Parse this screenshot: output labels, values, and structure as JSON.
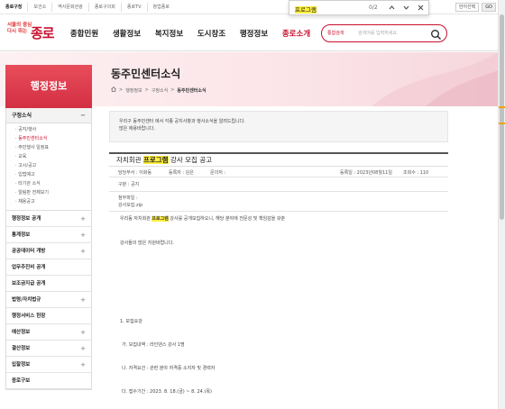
{
  "topbar": {
    "links": [
      "종로구청",
      "보건소",
      "역사문화관광",
      "종로구의회",
      "종로TV",
      "창업종로"
    ],
    "lang": "언어선택",
    "go": "GO"
  },
  "findbar": {
    "query": "프로그램",
    "count": "0/2"
  },
  "header": {
    "logo_small_line1": "서울의 중심",
    "logo_small_line2": "다시 뛰는",
    "logo_big": "종로",
    "gnb": [
      "종합민원",
      "생활정보",
      "복지정보",
      "도시창조",
      "행정정보",
      "종로소개"
    ],
    "search_select": "통합검색",
    "search_placeholder": "검색어를 입력하세요."
  },
  "page": {
    "title": "동주민센터소식",
    "breadcrumb": [
      "행정정보",
      "구정소식",
      "동주민센터소식"
    ]
  },
  "sidebar": {
    "title": "행정정보",
    "open_section": "구정소식",
    "open_toggle": "−",
    "subitems": [
      "공지/행사",
      "동주민센터소식",
      "주민행사 일정표",
      "교육",
      "고시/공고",
      "입법예고",
      "타기관 소식",
      "알림판 전체보기",
      "채용공고"
    ],
    "active_subitem": 1,
    "sections": [
      "행정정보 공개",
      "통계정보",
      "공공데이터 개방",
      "업무추진비 공개",
      "보조금지급 공개",
      "법령/자치법규",
      "행정서비스 헌장",
      "예산정보",
      "결산정보",
      "입찰정보",
      "종로구보"
    ],
    "expand_symbol": "+"
  },
  "article": {
    "intro_line1": "우리구 동주민센터 에서 각종 공지사항과 행사소식을 알려드립니다.",
    "intro_line2": "많은 애용바랍니다.",
    "title_prefix": "자치회관 ",
    "title_highlight": "프로그램",
    "title_suffix": " 강사 모집 공고",
    "dept": "담당부서 : 이화동",
    "author": "등록자 : 김은",
    "contact": "문의처 :",
    "date": "등록일 : 2023년08월11일",
    "views": "조회수 : 110",
    "category": "구분 : 공지",
    "attach_label": "첨부파일 :",
    "attach_file": "강사모집.zip",
    "body_pre": "우리동 자치회관 ",
    "body_hl": "프로그램",
    "body_post": " 강사를 공개모집하오니, 해당 분야에 전문성 및 책임감을 갖춘",
    "body2": "강사들의 많은 지원바랍니다.",
    "item1": "1. 모집요강",
    "item2": "가. 모집내역 : 라인댄스 강사 1명",
    "item3": "나. 자격요건 : 관련 분야 자격증 소지자 및 경력자",
    "item4": "다. 접수기간 : 2023. 8. 18.(금) ~ 8. 24.(목)"
  },
  "colors": {
    "brand": "#c8102e",
    "highlight": "#ffef3c"
  }
}
